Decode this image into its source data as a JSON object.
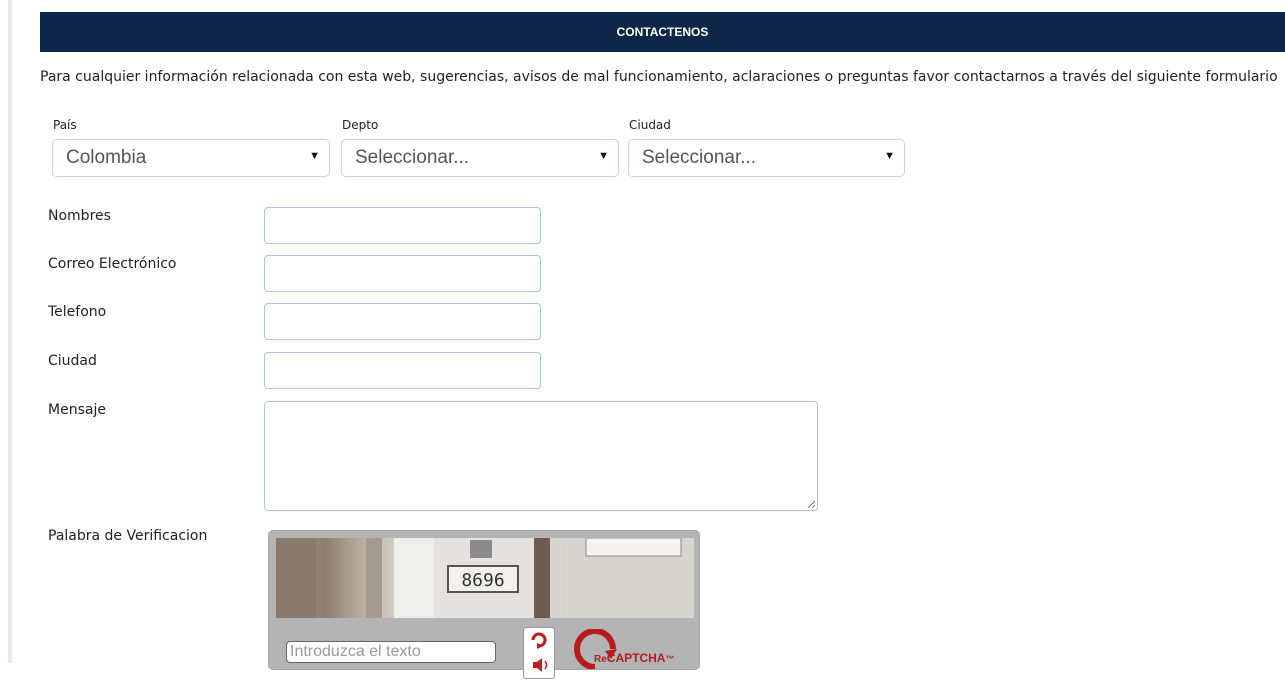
{
  "header": {
    "title": "CONTACTENOS"
  },
  "intro": {
    "text": "Para cualquier información relacionada con esta web, sugerencias, avisos de mal funcionamiento, aclaraciones o preguntas favor contactarnos a través del siguiente formulario"
  },
  "location": {
    "country": {
      "label": "País",
      "value": "Colombia"
    },
    "department": {
      "label": "Depto",
      "value": "Seleccionar..."
    },
    "city": {
      "label": "Ciudad",
      "value": "Seleccionar..."
    }
  },
  "form": {
    "name_label": "Nombres",
    "email_label": "Correo Electrónico",
    "phone_label": "Telefono",
    "city_label": "Ciudad",
    "message_label": "Mensaje",
    "verification_label": "Palabra de Verificacion"
  },
  "captcha": {
    "image_text": "8696",
    "input_placeholder": "Introduzca el texto",
    "brand_prefix": "Re",
    "brand": "CAPTCHA",
    "trademark": "™",
    "reload_icon": "reload-icon",
    "audio_icon": "audio-icon",
    "brand_color": "#b51c1c"
  },
  "colors": {
    "header_bg": "#0e2748",
    "field_border": "#a9c6ea"
  }
}
